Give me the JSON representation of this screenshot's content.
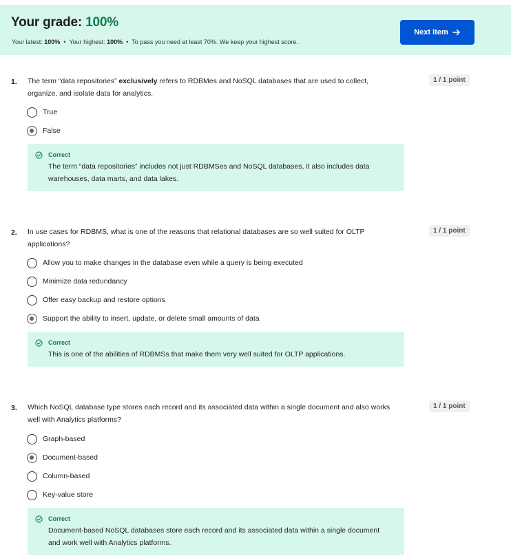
{
  "grade": {
    "label": "Your grade: ",
    "value": "100%",
    "latest_label": "Your latest: ",
    "latest_value": "100%",
    "highest_label": "Your highest: ",
    "highest_value": "100%",
    "bullet": "•",
    "pass_note": "To pass you need at least 70%. We keep your highest score."
  },
  "next_button": {
    "label": "Next item",
    "icon": "arrow-right-icon"
  },
  "colors": {
    "banner_bg": "#d6f7ec",
    "accent_green": "#137c4f",
    "primary_blue": "#0056d2"
  },
  "questions": [
    {
      "number": "1.",
      "text_before": "The term “data repositories” ",
      "text_bold": "exclusively",
      "text_after": " refers to RDBMes and NoSQL databases that are used to collect, organize, and isolate data for analytics.",
      "points": "1 / 1 point",
      "options": [
        {
          "label": "True",
          "selected": false
        },
        {
          "label": "False",
          "selected": true
        }
      ],
      "feedback_title": "Correct",
      "feedback_text": "The term “data repositories” includes not just RDBMSes and NoSQL databases, it also includes data warehouses, data marts, and data lakes."
    },
    {
      "number": "2.",
      "text": "In use cases for RDBMS, what is one of the reasons that relational databases are so well suited for OLTP applications?",
      "points": "1 / 1 point",
      "options": [
        {
          "label": "Allow you to make changes in the database even while a query is being executed",
          "selected": false
        },
        {
          "label": "Minimize data redundancy",
          "selected": false
        },
        {
          "label": "Offer easy backup and restore options",
          "selected": false
        },
        {
          "label": "Support the ability to insert, update, or delete small amounts of data",
          "selected": true
        }
      ],
      "feedback_title": "Correct",
      "feedback_text": "This is one of the abilities of RDBMSs that make them very well suited for OLTP applications."
    },
    {
      "number": "3.",
      "text": "Which NoSQL database type stores each record and its associated data within a single document and also works well with Analytics platforms?",
      "points": "1 / 1 point",
      "options": [
        {
          "label": "Graph-based",
          "selected": false
        },
        {
          "label": "Document-based",
          "selected": true
        },
        {
          "label": "Column-based",
          "selected": false
        },
        {
          "label": "Key-value store",
          "selected": false
        }
      ],
      "feedback_title": "Correct",
      "feedback_text": "Document-based NoSQL databases store each record and its associated data within a single document and work well with Analytics platforms."
    }
  ]
}
